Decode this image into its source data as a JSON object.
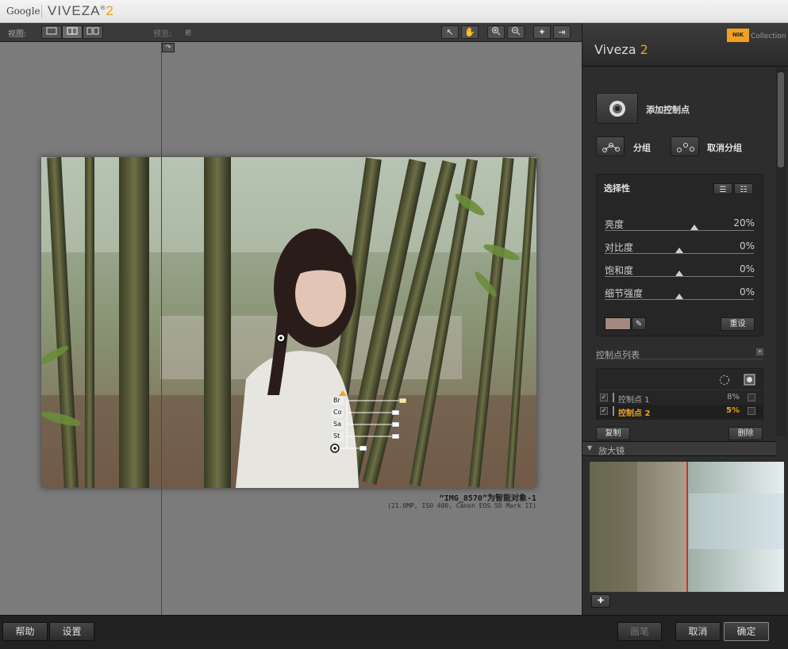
{
  "titlebar": {
    "google_label": "Google",
    "app_name": "VIVEZA",
    "app_version": "2",
    "registered": "®"
  },
  "toolbar": {
    "view_label": "视图:",
    "preview_label": "预览:",
    "view_modes": [
      "single-view-icon",
      "split-view-icon",
      "side-by-side-view-icon"
    ],
    "tools": [
      "pointer-icon",
      "hand-icon",
      "zoom-in-icon",
      "zoom-out-icon",
      "light-icon",
      "export-icon"
    ]
  },
  "canvas": {
    "image_caption": "“IMG_8570”为智能对象-1",
    "image_meta": "(21.0MP, ISO 400, Canon EOS 5D Mark II)",
    "control_point_labels": [
      "Br",
      "Co",
      "Sa",
      "St"
    ]
  },
  "panel": {
    "nik_logo": "NIK",
    "collection_label": "Collection",
    "title": "Viveza",
    "title_version": "2",
    "add_control_point": "添加控制点",
    "group": "分组",
    "ungroup": "取消分组",
    "selectivity": {
      "title": "选择性",
      "sliders": [
        {
          "label": "亮度",
          "value": "20%",
          "level": 0.6
        },
        {
          "label": "对比度",
          "value": "0%",
          "level": 0.5
        },
        {
          "label": "饱和度",
          "value": "0%",
          "level": 0.5
        },
        {
          "label": "细节强度",
          "value": "0%",
          "level": 0.5
        }
      ],
      "color_swatch": "#a58880",
      "reset_label": "重设"
    },
    "control_point_list": {
      "title": "控制点列表",
      "rows": [
        {
          "name": "控制点 1",
          "value": "8%",
          "checked": true,
          "active": false
        },
        {
          "name": "控制点 2",
          "value": "5%",
          "checked": true,
          "active": true
        }
      ],
      "copy_label": "复制",
      "delete_label": "删除"
    },
    "magnifier": {
      "title": "放大镜"
    }
  },
  "bottom": {
    "help": "帮助",
    "settings": "设置",
    "brush": "画笔",
    "cancel": "取消",
    "ok": "确定"
  },
  "colors": {
    "accent": "#f0a020",
    "split_line": "#d01010"
  }
}
